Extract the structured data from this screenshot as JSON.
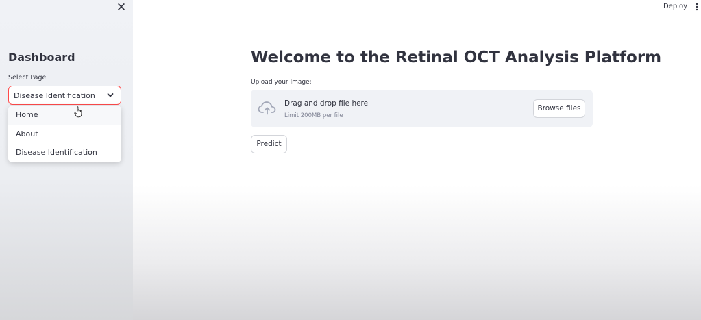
{
  "sidebar": {
    "title": "Dashboard",
    "select_label": "Select Page",
    "selected_value": "Disease Identification",
    "options": [
      "Home",
      "About",
      "Disease Identification"
    ]
  },
  "header": {
    "deploy_label": "Deploy"
  },
  "main": {
    "title": "Welcome to the Retinal OCT Analysis Platform",
    "upload_label": "Upload your Image:",
    "dropzone": {
      "title": "Drag and drop file here",
      "limit": "Limit 200MB per file",
      "browse_label": "Browse files"
    },
    "predict_label": "Predict"
  },
  "colors": {
    "accent": "#ff4b4b",
    "sidebar_bg": "#f0f2f6",
    "text": "#31333f",
    "muted_text": "#808495"
  },
  "icons": [
    "close-icon",
    "chevron-down-icon",
    "hand-pointer-icon",
    "cloud-upload-icon",
    "vertical-dots-icon"
  ]
}
